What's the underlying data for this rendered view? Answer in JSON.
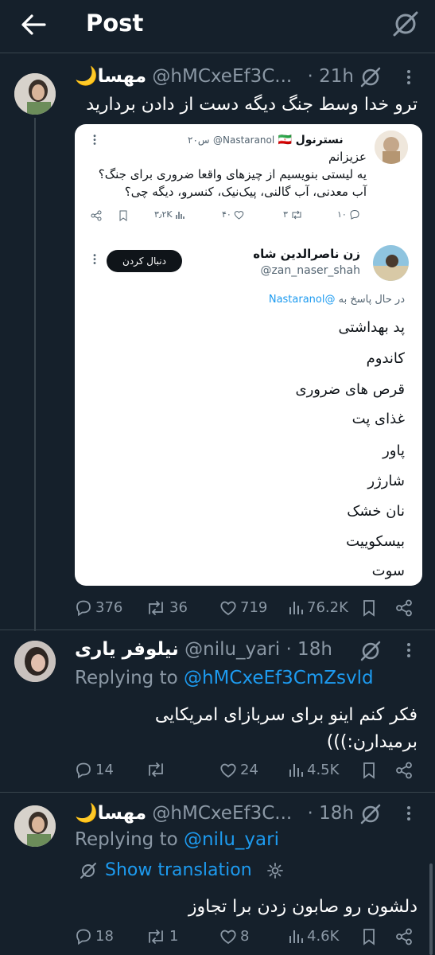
{
  "header": {
    "title": "Post"
  },
  "main_tweet": {
    "display_name": "مهسا",
    "moon": "🌙",
    "handle": "@hMCxeEf3C...",
    "time": "· 21h",
    "text": "ترو خدا وسط جنگ دیگه دست از دادن بردارید",
    "stats": {
      "replies": "376",
      "reposts": "36",
      "likes": "719",
      "views": "76.2K"
    }
  },
  "embed": {
    "quoted": {
      "display_name": "نسترنول",
      "flag": "🇮🇷",
      "handle": "@Nastaranol",
      "time": "۲۰س",
      "text_line1": "عزیزانم",
      "text_line2": "یه لیستی بنویسیم از چیزهای واقعا ضروری برای جنگ؟",
      "text_line3": "آب معدنی، آب گالنی، پیک‌نیک، کنسرو، دیگه چی؟",
      "stats": {
        "replies": "۱۰",
        "reposts": "۳",
        "likes": "۴۰",
        "views": "۳٫۲K"
      }
    },
    "reply": {
      "display_name": "زن ناصرالدین شاه",
      "handle": "@zan_naser_shah",
      "follow_label": "دنبال کردن",
      "replying_prefix": "در حال پاسخ به",
      "replying_to": "@Nastaranol",
      "items": [
        "پد بهداشتی",
        "کاندوم",
        "قرص های ضروری",
        "غذای پت",
        "پاور",
        "شارژر",
        "نان خشک",
        "بیسکوییت",
        "سوت"
      ]
    }
  },
  "reply1": {
    "display_name": "نیلوفر یاری",
    "handle": "@nilu_yari",
    "time": "· 18h",
    "replying_prefix": "Replying to",
    "replying_to": "@hMCxeEf3CmZsvld",
    "text_line1": "فکر کنم اینو برای سربازای امریکایی",
    "text_line2": "برمیدارن:)))",
    "stats": {
      "replies": "14",
      "reposts": "",
      "likes": "24",
      "views": "4.5K"
    }
  },
  "reply2": {
    "display_name": "مهسا",
    "moon": "🌙",
    "handle": "@hMCxeEf3C...",
    "time": "· 18h",
    "replying_prefix": "Replying to",
    "replying_to": "@nilu_yari",
    "translation_label": "Show translation",
    "text": "دلشون رو صابون زدن برا تجاوز",
    "stats": {
      "replies": "18",
      "reposts": "1",
      "likes": "8",
      "views": "4.6K"
    }
  },
  "colors": {
    "background": "#15202b",
    "accent": "#1d9bf0",
    "muted": "#8b98a5",
    "border": "#38444d"
  }
}
